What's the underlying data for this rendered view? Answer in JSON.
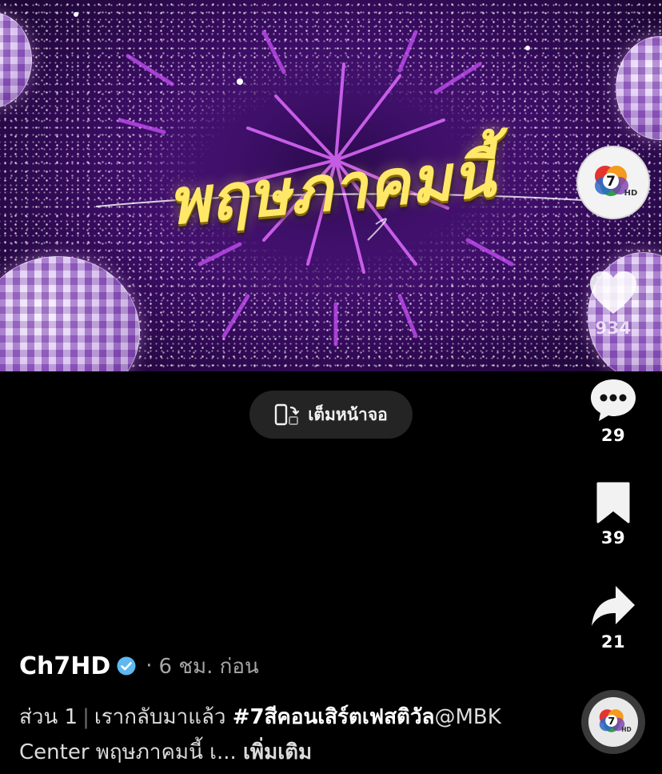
{
  "video": {
    "title_overlay": "พฤษภาคมนี้"
  },
  "fullscreen": {
    "label": "เต็มหน้าจอ",
    "icon": "fullscreen-rotate-icon"
  },
  "channel_logo": {
    "text": "7",
    "badge": "HD"
  },
  "actions": {
    "like_count": "934",
    "comment_count": "29",
    "save_count": "39",
    "share_count": "21"
  },
  "author": {
    "name": "Ch7HD",
    "verified": true,
    "separator": "·",
    "time": "6 ชม. ก่อน"
  },
  "caption": {
    "part": "ส่วน 1",
    "divider": "|",
    "text": "เรากลับมาแล้ว",
    "hashtag": "#7สีคอนเสิร์ตเฟสติวัล",
    "mention": "@MBK Center พฤษภาคมนี้ เ...",
    "more": "เพิ่มเติม"
  },
  "colors": {
    "background": "#000000",
    "title_yellow": "#ffe867",
    "verified_blue": "#5fb8f0",
    "pill_bg": "#242424"
  }
}
